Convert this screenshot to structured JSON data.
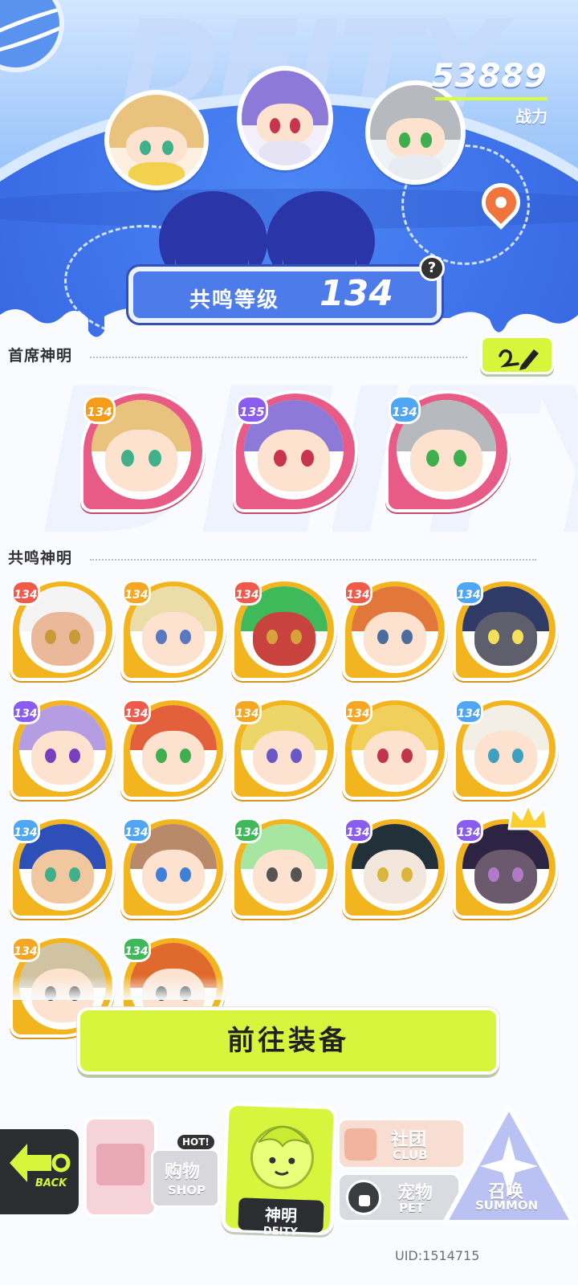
{
  "header": {
    "power_value": "53889",
    "power_label": "战力",
    "resonance_label": "共鸣等级",
    "resonance_level": "134",
    "help_glyph": "?"
  },
  "sections": {
    "chief_title": "首席神明",
    "resonance_title": "共鸣神明"
  },
  "chief_deities": [
    {
      "level": "134",
      "ring": "#e85b87",
      "badge": "#f59c1a",
      "hair": "#e9c27e",
      "eye": "#3fb08a",
      "body": "#f2d14d"
    },
    {
      "level": "135",
      "ring": "#e85b87",
      "badge": "#8a5cf0",
      "hair": "#8d7ad8",
      "eye": "#c8344e",
      "body": "#d9d4ef"
    },
    {
      "level": "134",
      "ring": "#e85b87",
      "badge": "#4fa6f2",
      "hair": "#b6b9be",
      "eye": "#3fae4f",
      "body": "#e7ecf2"
    }
  ],
  "resonance_deities": [
    {
      "level": "134",
      "badge": "#f05a4a",
      "hair": "#f4f4f4",
      "eye": "#c89a3a",
      "skin": "#e9b99a"
    },
    {
      "level": "134",
      "badge": "#f5a623",
      "hair": "#ecdca8",
      "eye": "#5a78c2",
      "skin": "#fde3cf"
    },
    {
      "level": "134",
      "badge": "#f05a4a",
      "hair": "#3fb95a",
      "eye": "#d9a13c",
      "skin": "#c8423e"
    },
    {
      "level": "134",
      "badge": "#f05a4a",
      "hair": "#e1773a",
      "eye": "#4d6c9e",
      "skin": "#fde3cf"
    },
    {
      "level": "134",
      "badge": "#4fa6f2",
      "hair": "#2f3b66",
      "eye": "#f3e15a",
      "skin": "#5f5e6d"
    },
    {
      "level": "134",
      "badge": "#8a5cf0",
      "hair": "#b59de3",
      "eye": "#7a3fbf",
      "skin": "#fde3cf"
    },
    {
      "level": "134",
      "badge": "#f05a4a",
      "hair": "#e2603c",
      "eye": "#3fae4f",
      "skin": "#fde3cf"
    },
    {
      "level": "134",
      "badge": "#f5a623",
      "hair": "#ecd66a",
      "eye": "#6a58c6",
      "skin": "#fde3cf"
    },
    {
      "level": "134",
      "badge": "#f5a623",
      "hair": "#f1cf5b",
      "eye": "#c0344e",
      "skin": "#fde3cf"
    },
    {
      "level": "134",
      "badge": "#4fa6f2",
      "hair": "#f3efe6",
      "eye": "#3f9fbf",
      "skin": "#fde3cf"
    },
    {
      "level": "134",
      "badge": "#4fa6f2",
      "hair": "#2f4fb8",
      "eye": "#3fb08a",
      "skin": "#f0c79f"
    },
    {
      "level": "134",
      "badge": "#4fa6f2",
      "hair": "#b98a6a",
      "eye": "#3f7fd8",
      "skin": "#fde3cf"
    },
    {
      "level": "134",
      "badge": "#3fb95a",
      "hair": "#a7e6a0",
      "eye": "#555555",
      "skin": "#fde3cf"
    },
    {
      "level": "134",
      "badge": "#8a5cf0",
      "hair": "#22303a",
      "eye": "#d9b53c",
      "skin": "#f3e6dc"
    },
    {
      "level": "134",
      "badge": "#8a5cf0",
      "hair": "#2d2342",
      "eye": "#b07ac8",
      "skin": "#6b5a6e"
    },
    {
      "level": "134",
      "badge": "#f5a623",
      "hair": "#cfc3a2",
      "eye": "#333333",
      "skin": "#fde3cf"
    },
    {
      "level": "134",
      "badge": "#3fb95a",
      "hair": "#e06a2c",
      "eye": "#333333",
      "skin": "#fde3cf"
    }
  ],
  "actions": {
    "equip_label": "前往装备"
  },
  "nav": {
    "back_label": "BACK",
    "shop_zh": "购物",
    "shop_en": "SHOP",
    "shop_hot": "HOT!",
    "deity_zh": "神明",
    "deity_en": "DEITY",
    "club_zh": "社团",
    "club_en": "CLUB",
    "pet_zh": "宠物",
    "pet_en": "PET",
    "summon_zh": "召唤",
    "summon_en": "SUMMON"
  },
  "footer": {
    "uid": "UID:1514715"
  },
  "colors": {
    "accent_lime": "#d8f53e",
    "planet_blue": "#3c6fe8",
    "card_gold": "#f3b51f",
    "chief_pink": "#e85b87"
  }
}
